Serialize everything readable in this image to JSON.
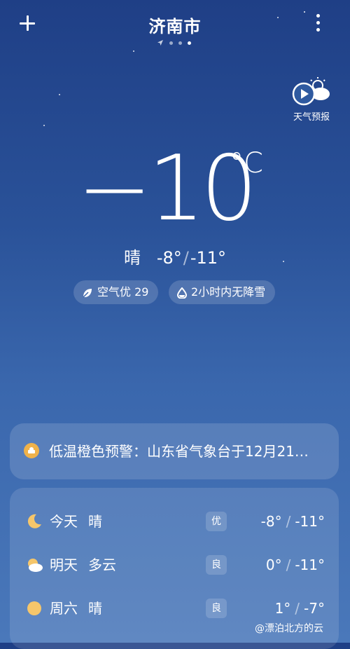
{
  "header": {
    "city": "济南市",
    "add_icon": "plus-icon",
    "more_icon": "more-vertical-icon"
  },
  "pager": {
    "count": 3,
    "active_index": 3,
    "location_icon": "location-arrow-icon"
  },
  "forecast_button": {
    "label": "天气预报",
    "icon": "play-cloud-icon"
  },
  "current": {
    "temperature": "−10",
    "unit": "°C",
    "condition": "晴",
    "high": "-8°",
    "sep": "/",
    "low": "-11°"
  },
  "pills": {
    "air": {
      "icon": "leaf-icon",
      "label": "空气优 29"
    },
    "precip": {
      "icon": "drop-icon",
      "label": "2小时内无降雪"
    }
  },
  "alert": {
    "icon": "low-temperature-warning-icon",
    "text": "低温橙色预警：山东省气象台于12月21…",
    "color": "#f0b24a"
  },
  "daily": [
    {
      "day": "今天",
      "condition": "晴",
      "icon": "moon-icon",
      "aqi": "优",
      "high": "-8°",
      "sep": "/",
      "low": "-11°"
    },
    {
      "day": "明天",
      "condition": "多云",
      "icon": "partly-cloudy-icon",
      "aqi": "良",
      "high": "0°",
      "sep": "/",
      "low": "-11°"
    },
    {
      "day": "周六",
      "condition": "晴",
      "icon": "sun-icon",
      "aqi": "良",
      "high": "1°",
      "sep": "/",
      "low": "-7°"
    }
  ],
  "watermark": "@漂泊北方的云"
}
